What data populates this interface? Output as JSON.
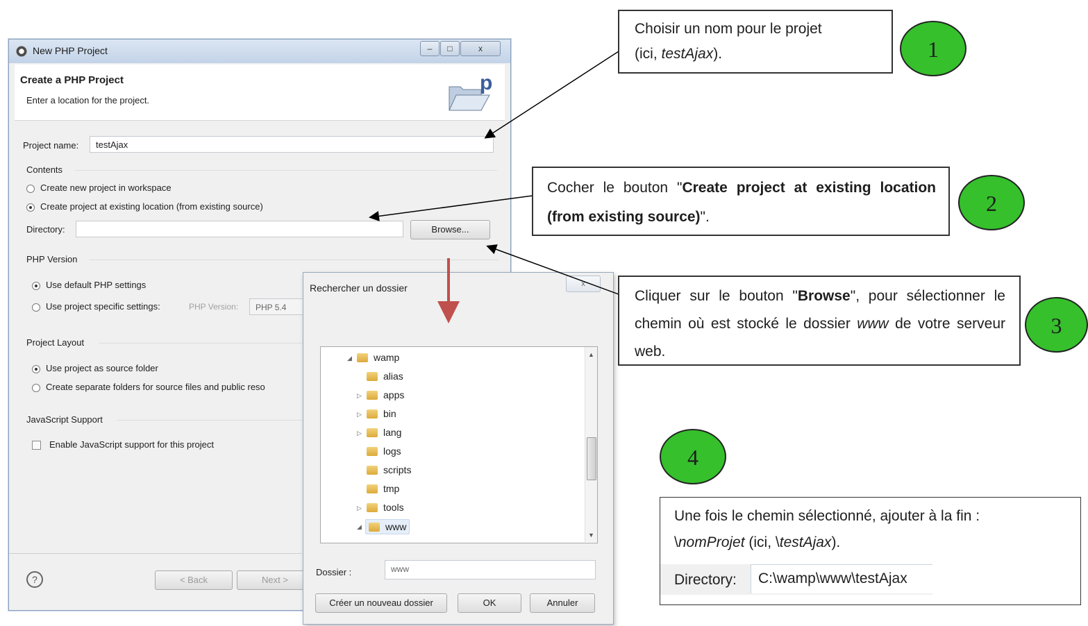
{
  "dialog": {
    "title": "New PHP Project",
    "header_title": "Create a PHP Project",
    "header_subtitle": "Enter a location for the project.",
    "project_name_label": "Project name:",
    "project_name_value": "testAjax",
    "contents_label": "Contents",
    "radio_new_workspace": "Create new project in workspace",
    "radio_existing_location": "Create project at existing location (from existing source)",
    "directory_label": "Directory:",
    "directory_value": "",
    "browse_label": "Browse...",
    "php_version_label": "PHP Version",
    "radio_default_php": "Use default PHP settings",
    "radio_specific_php": "Use project specific settings:",
    "php_version_inline_label": "PHP Version:",
    "php_version_value": "PHP 5.4",
    "project_layout_label": "Project Layout",
    "radio_source_folder": "Use project as source folder",
    "radio_separate_folders": "Create separate folders for source files and public reso",
    "js_support_label": "JavaScript Support",
    "js_checkbox_label": "Enable JavaScript support for this project",
    "back_label": "< Back",
    "next_label": "Next >",
    "help_icon": "?"
  },
  "folder_dialog": {
    "title": "Rechercher un dossier",
    "tree": [
      {
        "name": "wamp",
        "expanded": true
      },
      {
        "name": "alias"
      },
      {
        "name": "apps",
        "expandable": true
      },
      {
        "name": "bin",
        "expandable": true
      },
      {
        "name": "lang",
        "expandable": true
      },
      {
        "name": "logs"
      },
      {
        "name": "scripts"
      },
      {
        "name": "tmp"
      },
      {
        "name": "tools",
        "expandable": true
      },
      {
        "name": "www",
        "expanded": true,
        "selected": true
      }
    ],
    "folder_label": "Dossier :",
    "folder_value": "www",
    "new_folder_label": "Créer un nouveau dossier",
    "ok_label": "OK",
    "cancel_label": "Annuler"
  },
  "callouts": {
    "c1": {
      "number": "1",
      "text_a": "Choisir un nom pour le projet",
      "text_b": "(ici, ",
      "text_em": "testAjax",
      "text_c": ")."
    },
    "c2": {
      "number": "2",
      "text_a": "Cocher le bouton  \"",
      "text_strong": "Create project at existing location (from  existing source)",
      "text_c": "\"."
    },
    "c3": {
      "number": "3",
      "text_a": "Cliquer sur le bouton \"",
      "text_strong": "Browse",
      "text_b": "\", pour sélectionner le chemin où est stocké le dossier ",
      "text_em": "www",
      "text_c": " de votre serveur web."
    },
    "c4": {
      "number": "4",
      "line1": "Une fois le chemin sélectionné, ajouter à la fin :",
      "l2_a": "\\",
      "l2_em": "nomProjet",
      "l2_b": " (ici, \\",
      "l2_em2": "testAjax",
      "l2_c": ").",
      "dir_label": "Directory:",
      "dir_value": "C:\\wamp\\www\\testAjax"
    }
  },
  "colors": {
    "callout_circle": "#35c02c",
    "arrow_red": "#c0504d",
    "titlebar": "#c3d3e8"
  }
}
